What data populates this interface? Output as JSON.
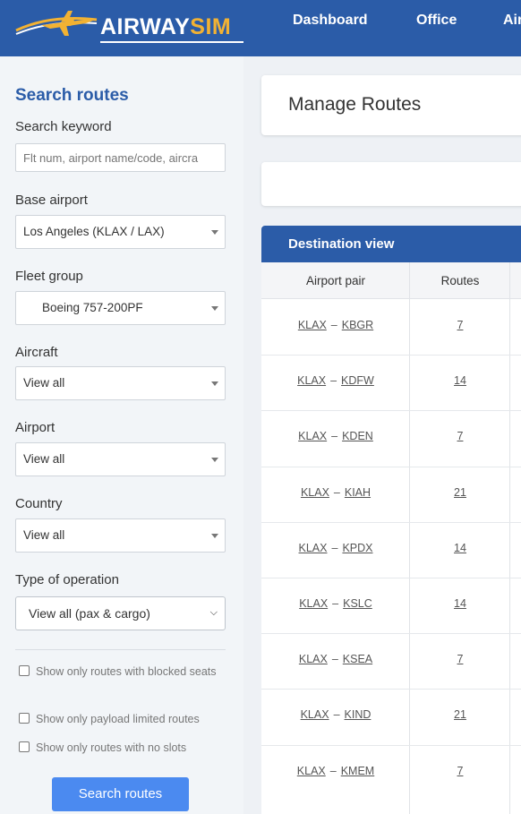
{
  "header": {
    "logo": {
      "part1": "AIRWAY",
      "part2": "SIM"
    },
    "nav": [
      "Dashboard",
      "Office",
      "Air"
    ],
    "colors": {
      "bar": "#2b5ca8",
      "accent": "#f2b233"
    }
  },
  "sidebar": {
    "title": "Search routes",
    "keyword_label": "Search keyword",
    "keyword_placeholder": "Flt num, airport name/code, aircra",
    "base_airport_label": "Base airport",
    "base_airport_value": "Los Angeles (KLAX / LAX)",
    "fleet_group_label": "Fleet group",
    "fleet_group_value": "Boeing 757-200PF",
    "aircraft_label": "Aircraft",
    "aircraft_value": "View all",
    "airport_label": "Airport",
    "airport_value": "View all",
    "country_label": "Country",
    "country_value": "View all",
    "operation_label": "Type of operation",
    "operation_value": "View all (pax & cargo)",
    "checkboxes": [
      "Show only routes with blocked seats",
      "Show only payload limited routes",
      "Show only routes with no slots"
    ],
    "search_button": "Search routes"
  },
  "main": {
    "title": "Manage Routes",
    "table_title": "Destination view",
    "columns": [
      "Airport pair",
      "Routes"
    ],
    "rows": [
      {
        "from": "KLAX",
        "to": "KBGR",
        "routes": "7"
      },
      {
        "from": "KLAX",
        "to": "KDFW",
        "routes": "14"
      },
      {
        "from": "KLAX",
        "to": "KDEN",
        "routes": "7"
      },
      {
        "from": "KLAX",
        "to": "KIAH",
        "routes": "21"
      },
      {
        "from": "KLAX",
        "to": "KPDX",
        "routes": "14"
      },
      {
        "from": "KLAX",
        "to": "KSLC",
        "routes": "14"
      },
      {
        "from": "KLAX",
        "to": "KSEA",
        "routes": "7"
      },
      {
        "from": "KLAX",
        "to": "KIND",
        "routes": "21"
      },
      {
        "from": "KLAX",
        "to": "KMEM",
        "routes": "7"
      }
    ]
  }
}
